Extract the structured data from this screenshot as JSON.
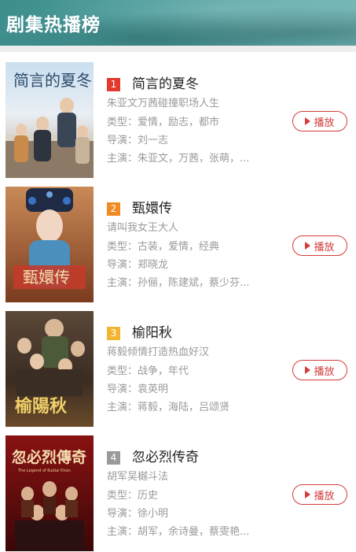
{
  "header": {
    "title": "剧集热播榜"
  },
  "button_color": "#d43c3c",
  "items": [
    {
      "rank": "1",
      "rank_color": "#e23b2e",
      "title": "简言的夏冬",
      "desc": "朱亚文万茜碰撞职场人生",
      "genre_label": "类型：",
      "genre": "爱情，励志，都市",
      "director_label": "导演：",
      "director": "刘一志",
      "cast_label": "主演：",
      "cast": "朱亚文，万茜，张萌，...",
      "play_label": "播放",
      "poster_text": "简言的夏冬",
      "poster_icon": "poster-1"
    },
    {
      "rank": "2",
      "rank_color": "#f08a24",
      "title": "甄嬛传",
      "desc": "请叫我女王大人",
      "genre_label": "类型：",
      "genre": "古装，爱情，经典",
      "director_label": "导演：",
      "director": "郑晓龙",
      "cast_label": "主演：",
      "cast": "孙俪，陈建斌，蔡少芬...",
      "play_label": "播放",
      "poster_text": "甄嬛传",
      "poster_icon": "poster-2"
    },
    {
      "rank": "3",
      "rank_color": "#f2b531",
      "title": "榆阳秋",
      "desc": "蒋毅倾情打造热血好汉",
      "genre_label": "类型：",
      "genre": "战争，年代",
      "director_label": "导演：",
      "director": "袁英明",
      "cast_label": "主演：",
      "cast": "蒋毅，海陆，吕颂贤",
      "play_label": "播放",
      "poster_text": "榆陽秋",
      "poster_icon": "poster-3"
    },
    {
      "rank": "4",
      "rank_color": "#9a9a9a",
      "title": "忽必烈传奇",
      "desc": "胡军吴樾斗法",
      "genre_label": "类型：",
      "genre": "历史",
      "director_label": "导演：",
      "director": "徐小明",
      "cast_label": "主演：",
      "cast": "胡军，余诗曼，蔡雯艳...",
      "play_label": "播放",
      "poster_text": "忽必烈傳奇",
      "poster_subtext": "The Legend of Kublai Khan",
      "poster_icon": "poster-4"
    }
  ]
}
